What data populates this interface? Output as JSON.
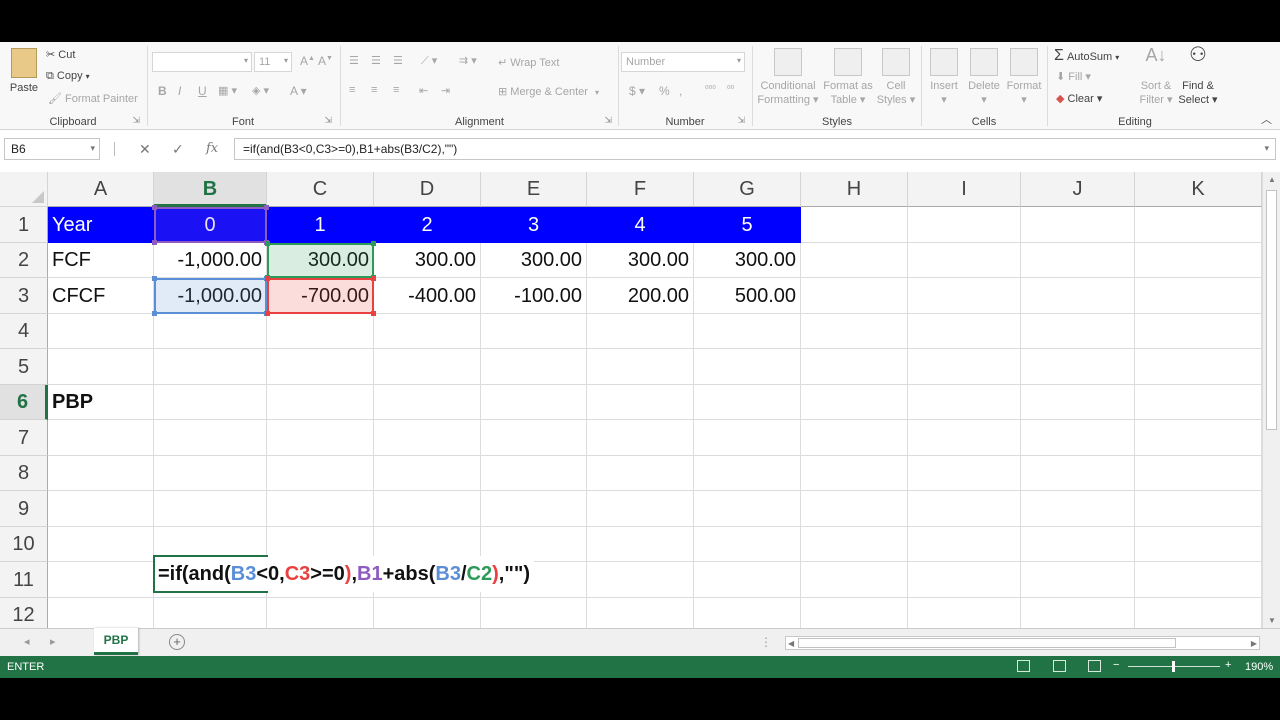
{
  "ribbon": {
    "clipboard": {
      "label": "Clipboard",
      "paste": "Paste",
      "cut": "Cut",
      "copy": "Copy",
      "format_painter": "Format Painter"
    },
    "font": {
      "label": "Font",
      "size": "11",
      "bold": "B",
      "italic": "I",
      "underline": "U"
    },
    "alignment": {
      "label": "Alignment",
      "wrap_text": "Wrap Text",
      "merge_center": "Merge & Center"
    },
    "number": {
      "label": "Number",
      "format": "Number",
      "currency": "$",
      "percent": "%",
      "comma": ","
    },
    "styles": {
      "label": "Styles",
      "conditional_1": "Conditional",
      "conditional_2": "Formatting",
      "format_table_1": "Format as",
      "format_table_2": "Table",
      "cell_styles_1": "Cell",
      "cell_styles_2": "Styles"
    },
    "cells": {
      "label": "Cells",
      "insert": "Insert",
      "delete": "Delete",
      "format": "Format"
    },
    "editing": {
      "label": "Editing",
      "autosum": "AutoSum",
      "fill": "Fill",
      "clear": "Clear",
      "sort_1": "Sort &",
      "sort_2": "Filter",
      "find_1": "Find &",
      "find_2": "Select"
    }
  },
  "formula_bar": {
    "name_box": "B6",
    "formula": "=if(and(B3<0,C3>=0),B1+abs(B3/C2),\"\")",
    "cancel_icon": "x-icon",
    "enter_icon": "check-icon",
    "function_icon": "fx-icon"
  },
  "grid": {
    "columns": [
      "A",
      "B",
      "C",
      "D",
      "E",
      "F",
      "G",
      "H",
      "I",
      "J",
      "K"
    ],
    "rows": [
      "1",
      "2",
      "3",
      "4",
      "5",
      "6",
      "7",
      "8",
      "9",
      "10",
      "11",
      "12"
    ],
    "selected_column": "B",
    "selected_row": "6",
    "header_fill": "#0000ff",
    "cells": {
      "A1": "Year",
      "B1": "0",
      "C1": "1",
      "D1": "2",
      "E1": "3",
      "F1": "4",
      "G1": "5",
      "A2": "FCF",
      "B2": "-1,000.00",
      "C2": "300.00",
      "D2": "300.00",
      "E2": "300.00",
      "F2": "300.00",
      "G2": "300.00",
      "A3": "CFCF",
      "B3": "-1,000.00",
      "C3": "-700.00",
      "D3": "-400.00",
      "E3": "-100.00",
      "F3": "200.00",
      "G3": "500.00",
      "A6": "PBP"
    },
    "editing_formula": [
      {
        "t": "=if(and(",
        "c": "#111111"
      },
      {
        "t": "B3",
        "c": "#5b8ed6"
      },
      {
        "t": "<0,",
        "c": "#111111"
      },
      {
        "t": "C3",
        "c": "#e8413f"
      },
      {
        "t": ">=0",
        "c": "#111111"
      },
      {
        "t": ")",
        "c": "#e8413f"
      },
      {
        "t": ",",
        "c": "#111111"
      },
      {
        "t": "B1",
        "c": "#8e5cc1"
      },
      {
        "t": "+abs(",
        "c": "#111111"
      },
      {
        "t": "B3",
        "c": "#5b8ed6"
      },
      {
        "t": "/",
        "c": "#111111"
      },
      {
        "t": "C2",
        "c": "#2e9a57"
      },
      {
        "t": ")",
        "c": "#e8413f"
      },
      {
        "t": ",\"\")",
        "c": "#111111"
      }
    ],
    "reference_colors": {
      "B1": "#8e5cc1",
      "C2": "#2e9a57",
      "B3": "#5b8ed6",
      "C3": "#e8413f"
    }
  },
  "sheet_tabs": {
    "active": "PBP",
    "add_icon": "plus-icon"
  },
  "status_bar": {
    "mode": "ENTER",
    "zoom": "190%",
    "accent": "#217346"
  }
}
